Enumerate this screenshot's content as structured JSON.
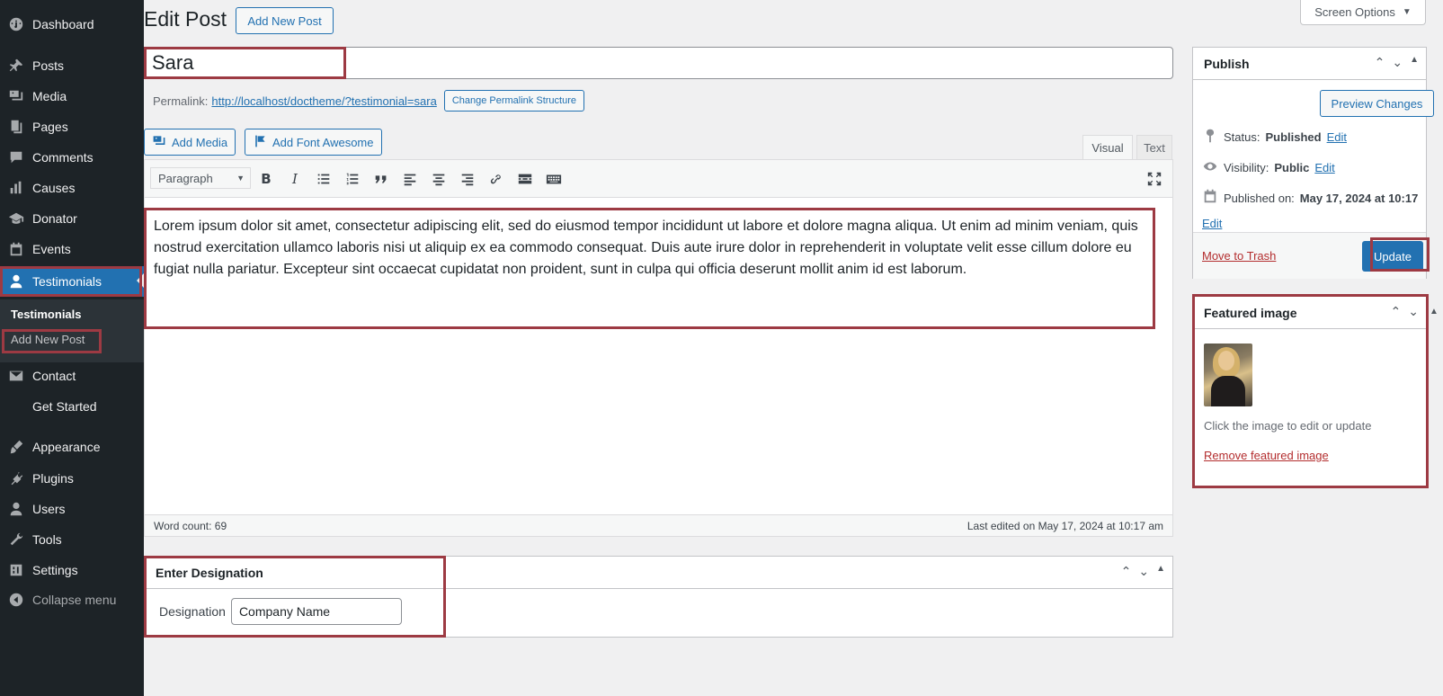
{
  "sidebar": {
    "items": [
      {
        "label": "Dashboard",
        "icon": "dashboard-icon"
      },
      {
        "label": "Posts",
        "icon": "pin-icon"
      },
      {
        "label": "Media",
        "icon": "media-icon"
      },
      {
        "label": "Pages",
        "icon": "pages-icon"
      },
      {
        "label": "Comments",
        "icon": "comments-icon"
      },
      {
        "label": "Causes",
        "icon": "chart-icon"
      },
      {
        "label": "Donator",
        "icon": "mortarboard-icon"
      },
      {
        "label": "Events",
        "icon": "calendar-icon"
      },
      {
        "label": "Testimonials",
        "icon": "user-icon"
      },
      {
        "label": "Contact",
        "icon": "mail-icon"
      },
      {
        "label": "Get Started",
        "icon": ""
      },
      {
        "label": "Appearance",
        "icon": "brush-icon"
      },
      {
        "label": "Plugins",
        "icon": "plug-icon"
      },
      {
        "label": "Users",
        "icon": "users-icon"
      },
      {
        "label": "Tools",
        "icon": "wrench-icon"
      },
      {
        "label": "Settings",
        "icon": "settings-icon"
      },
      {
        "label": "Collapse menu",
        "icon": "collapse-icon"
      }
    ],
    "submenu": {
      "current": "Testimonials",
      "add_new": "Add New Post"
    }
  },
  "header": {
    "title": "Edit Post",
    "add_new": "Add New Post",
    "screen_options": "Screen Options"
  },
  "post": {
    "title": "Sara",
    "permalink_label": "Permalink:",
    "permalink_url": "http://localhost/doctheme/?testimonial=sara",
    "change_permalink": "Change Permalink Structure"
  },
  "editor": {
    "add_media": "Add Media",
    "add_font_awesome": "Add Font Awesome",
    "tab_visual": "Visual",
    "tab_text": "Text",
    "format": "Paragraph",
    "content": "Lorem ipsum dolor sit amet, consectetur adipiscing elit, sed do eiusmod tempor incididunt ut labore et dolore magna aliqua. Ut enim ad minim veniam, quis nostrud exercitation ullamco laboris nisi ut aliquip ex ea commodo consequat. Duis aute irure dolor in reprehenderit in voluptate velit esse cillum dolore eu fugiat nulla pariatur. Excepteur sint occaecat cupidatat non proident, sunt in culpa qui officia deserunt mollit anim id est laborum.",
    "word_count": "Word count: 69",
    "last_edited": "Last edited on May 17, 2024 at 10:17 am"
  },
  "designation": {
    "title": "Enter Designation",
    "label": "Designation",
    "value": "Company Name"
  },
  "publish": {
    "title": "Publish",
    "preview": "Preview Changes",
    "status_label": "Status:",
    "status_value": "Published",
    "visibility_label": "Visibility:",
    "visibility_value": "Public",
    "published_label": "Published on:",
    "published_value": "May 17, 2024 at 10:17",
    "edit": "Edit",
    "trash": "Move to Trash",
    "update": "Update"
  },
  "featured": {
    "title": "Featured image",
    "hint": "Click the image to edit or update",
    "remove": "Remove featured image"
  },
  "colors": {
    "accent": "#2271b1",
    "highlight": "#9d3a43",
    "sidebar": "#1d2327"
  }
}
